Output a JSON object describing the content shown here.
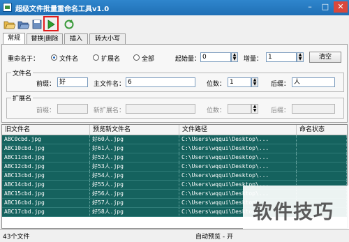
{
  "window": {
    "title": "超级文件批量重命名工具v1.0",
    "minimize": "–",
    "maximize": "□",
    "close": "✕"
  },
  "toolbar": {
    "icons": [
      "open-file-icon",
      "open-folder-icon",
      "save-icon",
      "play-icon",
      "refresh-icon"
    ]
  },
  "tabs": [
    "常规",
    "替换|删除",
    "插入",
    "转大小写"
  ],
  "rename": {
    "label": "重命名于：",
    "options": [
      "文件名",
      "扩展名",
      "全部"
    ],
    "selected": "文件名",
    "start_label": "起始量：",
    "start_value": "0",
    "step_label": "增量：",
    "step_value": "1",
    "clear_button": "清空"
  },
  "filename_group": {
    "title": "文件名",
    "prefix_label": "前缀：",
    "prefix_value": "好",
    "main_label": "主文件名：",
    "main_value": "6",
    "digits_label": "位数：",
    "digits_value": "1",
    "suffix_label": "后缀：",
    "suffix_value": "人"
  },
  "ext_group": {
    "title": "扩展名",
    "prefix_label": "前缀：",
    "new_ext_label": "新扩展名：",
    "digits_label": "位数：",
    "suffix_label": "后缀："
  },
  "table": {
    "columns": [
      "旧文件名",
      "预览新文件名",
      "文件路径",
      "命名状态"
    ],
    "rows": [
      [
        "ABC0cbd.jpg",
        "好60人.jpg",
        "C:\\Users\\wqqui\\Desktop\\...",
        ""
      ],
      [
        "ABC10cbd.jpg",
        "好61人.jpg",
        "C:\\Users\\wqqui\\Desktop\\...",
        ""
      ],
      [
        "ABC11cbd.jpg",
        "好52人.jpg",
        "C:\\Users\\wqqui\\Desktop\\...",
        ""
      ],
      [
        "ABC12cbd.jpg",
        "好53人.jpg",
        "C:\\Users\\wqqui\\Desktop\\...",
        ""
      ],
      [
        "ABC13cbd.jpg",
        "好54人.jpg",
        "C:\\Users\\wqqui\\Desktop\\...",
        ""
      ],
      [
        "ABC14cbd.jpg",
        "好55人.jpg",
        "C:\\Users\\wqqui\\Desktop\\...",
        ""
      ],
      [
        "ABC15cbd.jpg",
        "好56人.jpg",
        "C:\\Users\\wqqui\\Desktop\\...",
        ""
      ],
      [
        "ABC16cbd.jpg",
        "好57人.jpg",
        "C:\\Users\\wqqui\\Desktop\\...",
        ""
      ],
      [
        "ABC17cbd.jpg",
        "好58人.jpg",
        "C:\\Users\\wqqui\\Desktop\\...",
        ""
      ]
    ]
  },
  "status": {
    "count": "43个文件",
    "mode": "自动预览 - 开"
  },
  "watermark": "软件技巧",
  "colors": {
    "title_bar": "#2f86cd",
    "selected_row": "#15625e",
    "highlight": "#e21b1b"
  }
}
